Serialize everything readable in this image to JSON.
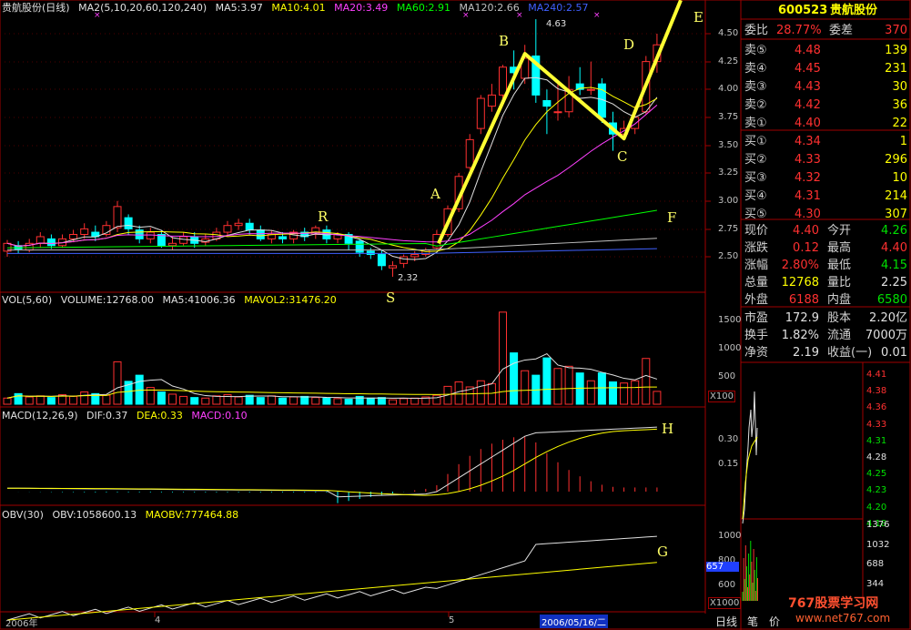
{
  "price_panel": {
    "title": "贵航股份(日线)",
    "ma_label": "MA2(5,10,20,60,120,240)",
    "ma_values": [
      {
        "label": "MA5:3.97",
        "color": "#e0e0e0"
      },
      {
        "label": "MA10:4.01",
        "color": "#ffff00"
      },
      {
        "label": "MA20:3.49",
        "color": "#ff40ff"
      },
      {
        "label": "MA60:2.91",
        "color": "#00ff00"
      },
      {
        "label": "MA120:2.66",
        "color": "#c0c0c0"
      },
      {
        "label": "MA240:2.57",
        "color": "#4060ff"
      }
    ],
    "y_ticks": [
      "4.50",
      "4.25",
      "4.00",
      "3.75",
      "3.50",
      "3.25",
      "3.00",
      "2.75",
      "2.50"
    ],
    "high_label": "4.63",
    "low_label": "2.32",
    "annotations": [
      "A",
      "B",
      "C",
      "D",
      "E",
      "F",
      "R",
      "S"
    ]
  },
  "volume_panel": {
    "title": "VOL(5,60)",
    "values": [
      {
        "label": "VOLUME:12768.00",
        "color": "#e0e0e0"
      },
      {
        "label": "MA5:41006.36",
        "color": "#e0e0e0"
      },
      {
        "label": "MAVOL2:31476.20",
        "color": "#ffff00"
      }
    ],
    "y_ticks": [
      "1500",
      "1000",
      "500"
    ],
    "unit": "X100"
  },
  "macd_panel": {
    "title": "MACD(12,26,9)",
    "values": [
      {
        "label": "DIF:0.37",
        "color": "#e0e0e0"
      },
      {
        "label": "DEA:0.33",
        "color": "#ffff00"
      },
      {
        "label": "MACD:0.10",
        "color": "#ff40ff"
      }
    ],
    "y_ticks": [
      "0.30",
      "0.15"
    ],
    "annotation": "H"
  },
  "obv_panel": {
    "title": "OBV(30)",
    "values": [
      {
        "label": "OBV:1058600.13",
        "color": "#e0e0e0"
      },
      {
        "label": "MAOBV:777464.88",
        "color": "#ffff00"
      }
    ],
    "y_ticks": [
      "1000",
      "800",
      "600"
    ],
    "marker": "657",
    "unit": "X1000",
    "annotation": "G"
  },
  "time_axis": {
    "labels": [
      "2006年",
      "4",
      "5"
    ],
    "cursor_date": "2006/05/16/二"
  },
  "quote": {
    "code": "600523",
    "name": "贵航股份",
    "webi_label": "委比",
    "webi_value": "28.77%",
    "weicha_label": "委差",
    "weicha_value": "370",
    "asks": [
      {
        "label": "卖⑤",
        "price": "4.48",
        "vol": "139"
      },
      {
        "label": "卖④",
        "price": "4.45",
        "vol": "231"
      },
      {
        "label": "卖③",
        "price": "4.43",
        "vol": "30"
      },
      {
        "label": "卖②",
        "price": "4.42",
        "vol": "36"
      },
      {
        "label": "卖①",
        "price": "4.40",
        "vol": "22"
      }
    ],
    "bids": [
      {
        "label": "买①",
        "price": "4.34",
        "vol": "1"
      },
      {
        "label": "买②",
        "price": "4.33",
        "vol": "296"
      },
      {
        "label": "买③",
        "price": "4.32",
        "vol": "10"
      },
      {
        "label": "买④",
        "price": "4.31",
        "vol": "214"
      },
      {
        "label": "买⑤",
        "price": "4.30",
        "vol": "307"
      }
    ],
    "stats": [
      [
        {
          "l": "现价",
          "v": "4.40",
          "c": "r"
        },
        {
          "l": "今开",
          "v": "4.26",
          "c": "g"
        }
      ],
      [
        {
          "l": "涨跌",
          "v": "0.12",
          "c": "r"
        },
        {
          "l": "最高",
          "v": "4.40",
          "c": "r"
        }
      ],
      [
        {
          "l": "涨幅",
          "v": "2.80%",
          "c": "r"
        },
        {
          "l": "最低",
          "v": "4.15",
          "c": "g"
        }
      ],
      [
        {
          "l": "总量",
          "v": "12768",
          "c": "y"
        },
        {
          "l": "量比",
          "v": "2.25",
          "c": "w"
        }
      ],
      [
        {
          "l": "外盘",
          "v": "6188",
          "c": "r"
        },
        {
          "l": "内盘",
          "v": "6580",
          "c": "g"
        }
      ]
    ],
    "stats2": [
      [
        {
          "l": "市盈",
          "v": "172.9"
        },
        {
          "l": "股本",
          "v": "2.20亿"
        }
      ],
      [
        {
          "l": "换手",
          "v": "1.82%"
        },
        {
          "l": "流通",
          "v": "7000万"
        }
      ],
      [
        {
          "l": "净资",
          "v": "2.19"
        },
        {
          "l": "收益(一)",
          "v": "0.01"
        }
      ]
    ]
  },
  "mini_chart": {
    "price_ticks": [
      "4.41",
      "4.38",
      "4.36",
      "4.33",
      "4.31",
      "4.28",
      "4.25",
      "4.23",
      "4.20",
      "4.18"
    ],
    "vol_ticks": [
      "1376",
      "1032",
      "688",
      "344"
    ]
  },
  "bottom_tabs": [
    "日线",
    "笔",
    "价"
  ],
  "watermark": "767股票学习网",
  "watermark_url": "www.net767.com",
  "colors": {
    "up": "#ff3030",
    "down": "#00ffff",
    "bg": "#000000",
    "border": "#a00000"
  }
}
